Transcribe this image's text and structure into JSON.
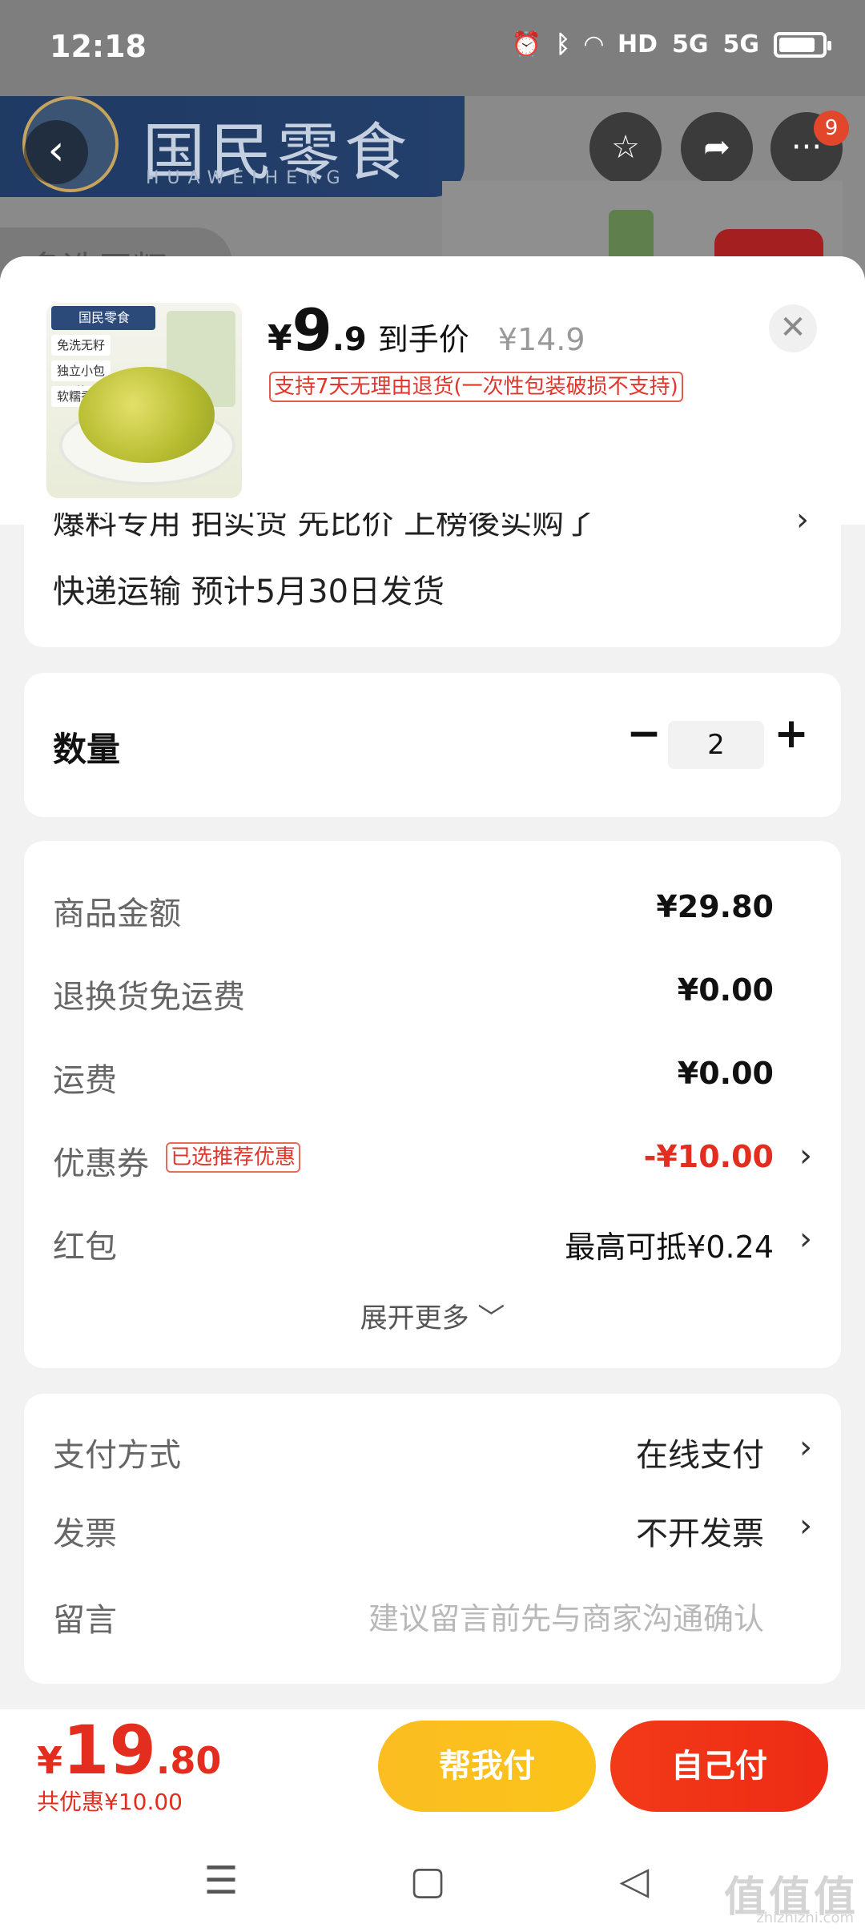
{
  "status_bar": {
    "time": "12:18",
    "icons": [
      "alarm-icon",
      "bluetooth-icon",
      "wifi-icon",
      "hd-icon",
      "signal-5g-icon",
      "signal-5g-icon",
      "battery-icon"
    ],
    "hd_label": "HD",
    "net1": "5G",
    "net2": "5G"
  },
  "background_page": {
    "store_name": "国民零食",
    "store_pinyin": "HUAWEIHENG",
    "notification_count": "9",
    "chip_text": "多选无籽"
  },
  "product": {
    "image_tags": [
      "免洗无籽",
      "独立小包装",
      "软糯香甜"
    ],
    "image_logo": "国民零食",
    "price_symbol": "¥",
    "price_integer": "9",
    "price_decimal": ".9",
    "price_label": "到手价",
    "original_price": "¥14.9",
    "return_policy": "支持7天无理由退货(一次性包装破损不支持)"
  },
  "address": {
    "cut_text": "爆料专用 拍实货 先比价 上榜後实购了",
    "shipping": "快递运输 预计5月30日发货"
  },
  "quantity": {
    "label": "数量",
    "value": "2",
    "minus": "−",
    "plus": "+"
  },
  "fees": {
    "goods_amount": {
      "label": "商品金额",
      "value": "¥29.80"
    },
    "return_shipping": {
      "label": "退换货免运费",
      "value": "¥0.00"
    },
    "shipping": {
      "label": "运费",
      "value": "¥0.00"
    },
    "coupon": {
      "label": "优惠券",
      "tag": "已选推荐优惠",
      "value": "-¥10.00"
    },
    "red_packet": {
      "label": "红包",
      "value": "最高可抵¥0.24"
    },
    "expand_more": "展开更多 ﹀"
  },
  "payment": {
    "method": {
      "label": "支付方式",
      "value": "在线支付"
    },
    "invoice": {
      "label": "发票",
      "value": "不开发票"
    },
    "message": {
      "label": "留言",
      "placeholder": "建议留言前先与商家沟通确认"
    }
  },
  "footer": {
    "total_symbol": "¥",
    "total_integer": "19",
    "total_decimal": ".80",
    "total_discount": "共优惠¥10.00",
    "help_pay": "帮我付",
    "self_pay": "自己付"
  },
  "watermark": {
    "text": "值值值",
    "sub": "zhizhizhi.com"
  },
  "colors": {
    "accent_red": "#e22d1f",
    "help_pay_yellow": "#fbbd22",
    "self_pay_red": "#f23a18"
  }
}
